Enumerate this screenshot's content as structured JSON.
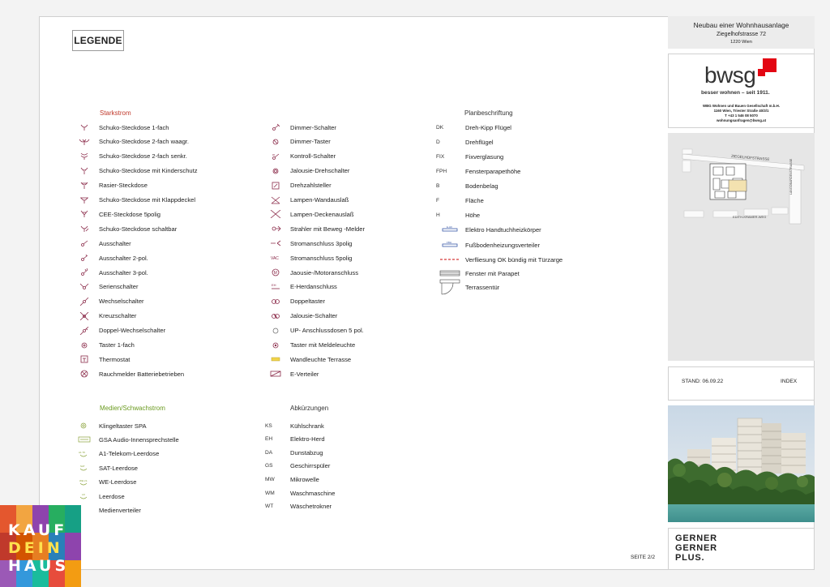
{
  "legend_title": "LEGENDE",
  "sections": {
    "starkstrom": "Starkstrom",
    "medien": "Medien/Schwachstrom",
    "abkuerzungen": "Abkürzungen",
    "planbeschriftung": "Planbeschriftung"
  },
  "col1": [
    {
      "label": "Schuko-Steckdose 1-fach",
      "icon": "socket-icon"
    },
    {
      "label": "Schuko-Steckdose 2-fach waagr.",
      "icon": "double-socket-horizontal-icon"
    },
    {
      "label": "Schuko-Steckdose 2-fach senkr.",
      "icon": "double-socket-vertical-icon"
    },
    {
      "label": "Schuko-Steckdose mit Kinderschutz",
      "icon": "child-safe-socket-icon"
    },
    {
      "label": "Rasier-Steckdose",
      "icon": "shaver-socket-icon"
    },
    {
      "label": "Schuko-Steckdose mit Klappdeckel",
      "icon": "flap-socket-icon"
    },
    {
      "label": "CEE-Steckdose 5polig",
      "icon": "cee-socket-icon"
    },
    {
      "label": "Schuko-Steckdose schaltbar",
      "icon": "switched-socket-icon"
    },
    {
      "label": "Ausschalter",
      "icon": "switch-icon"
    },
    {
      "label": "Ausschalter 2-pol.",
      "icon": "switch-2pole-icon"
    },
    {
      "label": "Ausschalter 3-pol.",
      "icon": "switch-3pole-icon"
    },
    {
      "label": "Serienschalter",
      "icon": "series-switch-icon"
    },
    {
      "label": "Wechselschalter",
      "icon": "two-way-switch-icon"
    },
    {
      "label": "Kreuzschalter",
      "icon": "cross-switch-icon"
    },
    {
      "label": "Doppel-Wechselschalter",
      "icon": "double-two-way-switch-icon"
    },
    {
      "label": "Taster 1-fach",
      "icon": "push-button-icon"
    },
    {
      "label": "Thermostat",
      "icon": "thermostat-icon"
    },
    {
      "label": "Rauchmelder Batteriebetrieben",
      "icon": "smoke-detector-icon"
    }
  ],
  "col2": [
    {
      "label": "Dimmer-Schalter",
      "icon": "dimmer-switch-icon"
    },
    {
      "label": "Dimmer-Taster",
      "icon": "dimmer-button-icon"
    },
    {
      "label": "Kontroll-Schalter",
      "icon": "control-switch-icon"
    },
    {
      "label": "Jalousie-Drehschalter",
      "icon": "blind-rotary-switch-icon"
    },
    {
      "label": "Drehzahlsteller",
      "icon": "speed-controller-icon"
    },
    {
      "label": "Lampen-Wandauslaß",
      "icon": "wall-lamp-outlet-icon"
    },
    {
      "label": "Lampen-Deckenauslaß",
      "icon": "ceiling-lamp-outlet-icon"
    },
    {
      "label": "Strahler mit Beweg -Melder",
      "icon": "spotlight-motion-icon"
    },
    {
      "label": "Stromanschluss 3polig",
      "icon": "power-connection-3pole-icon"
    },
    {
      "label": "Stromanschluss 5polig",
      "icon": "power-connection-5pole-icon"
    },
    {
      "label": "Jaousie-/Motoranschluss",
      "icon": "motor-connection-icon"
    },
    {
      "label": "E-Herdanschluss",
      "icon": "stove-connection-icon"
    },
    {
      "label": "Doppeltaster",
      "icon": "double-button-icon"
    },
    {
      "label": "Jalousie-Schalter",
      "icon": "blind-switch-icon"
    },
    {
      "label": "UP- Anschlussdosen 5 pol.",
      "icon": "flush-box-icon"
    },
    {
      "label": "Taster mit Meldeleuchte",
      "icon": "button-indicator-icon"
    },
    {
      "label": "Wandleuchte Terrasse",
      "icon": "terrace-wall-light-icon"
    },
    {
      "label": "E-Verteiler",
      "icon": "distribution-board-icon"
    }
  ],
  "plan": [
    {
      "code": "DK",
      "label": "Dreh-Kipp Flügel"
    },
    {
      "code": "D",
      "label": "Drehflügel"
    },
    {
      "code": "FIX",
      "label": "Fixverglasung"
    },
    {
      "code": "FPH",
      "label": "Fensterparapethöhe"
    },
    {
      "code": "B",
      "label": "Bodenbelag"
    },
    {
      "code": "F",
      "label": "Fläche"
    },
    {
      "code": "H",
      "label": "Höhe"
    },
    {
      "code": "",
      "label": "Elektro Handtuchheizkörper",
      "icon": "towel-radiator-icon"
    },
    {
      "code": "",
      "label": "Fußbodenheizungsverteiler",
      "icon": "floor-heating-distributor-icon"
    },
    {
      "code": "",
      "label": "Verfliesung OK bündig mit Türzarge",
      "icon": "tiling-line-icon"
    },
    {
      "code": "",
      "label": "Fenster mit Parapet",
      "icon": "window-parapet-icon"
    },
    {
      "code": "",
      "label": "Terrassentür",
      "icon": "terrace-door-icon"
    }
  ],
  "medien": [
    {
      "label": "Klingeltaster SPA",
      "icon": "doorbell-icon"
    },
    {
      "label": "GSA Audio-Innensprechstelle",
      "icon": "intercom-icon"
    },
    {
      "label": "A1-Telekom-Leerdose",
      "icon": "telekom-box-icon"
    },
    {
      "label": "SAT-Leerdose",
      "icon": "sat-box-icon"
    },
    {
      "label": "WE-Leerdose",
      "icon": "we-box-icon"
    },
    {
      "label": "Leerdose",
      "icon": "empty-box-icon"
    },
    {
      "label": "Medienverteiler",
      "icon": ""
    }
  ],
  "abkuerzungen": [
    {
      "code": "KS",
      "label": "Kühlschrank"
    },
    {
      "code": "EH",
      "label": "Elektro-Herd"
    },
    {
      "code": "DA",
      "label": "Dunstabzug"
    },
    {
      "code": "GS",
      "label": "Geschirrspüler"
    },
    {
      "code": "MW",
      "label": "Mikrowelle"
    },
    {
      "code": "WM",
      "label": "Waschmaschine"
    },
    {
      "code": "WT",
      "label": "Wäschetrokner"
    }
  ],
  "project": {
    "title": "Neubau einer Wohnhausanlage",
    "street": "Ziegelhofstrasse 72",
    "city": "1220 Wien"
  },
  "bwsg": {
    "name": "bwsg",
    "slogan": "besser wohnen – seit 1911.",
    "line1": "WBG Wohnen und Bauen Gesellschaft m.b.H.",
    "line2": "1160 Wien, Triester Straße 40/3/1",
    "line3": "T +43 1 546 08 5070",
    "line4": "wohnungsanfragen@bwsg.at",
    "accent": "#e30613"
  },
  "map": {
    "street_top": "ZIEGELHOFSTRASSE",
    "street_bottom": "EDITH-KRAMER-WEG",
    "street_right": "LANGOBARDENSTRASSE"
  },
  "stand": {
    "label": "STAND: 06.09.22",
    "index": "INDEX"
  },
  "gerner": {
    "line1": "GERNER",
    "line2": "GERNER",
    "line3": "PLUS."
  },
  "seite": "SEITE 2/2",
  "kauf": {
    "row1": "KAUF",
    "row2": "DEIN",
    "row3": "HAUS"
  }
}
